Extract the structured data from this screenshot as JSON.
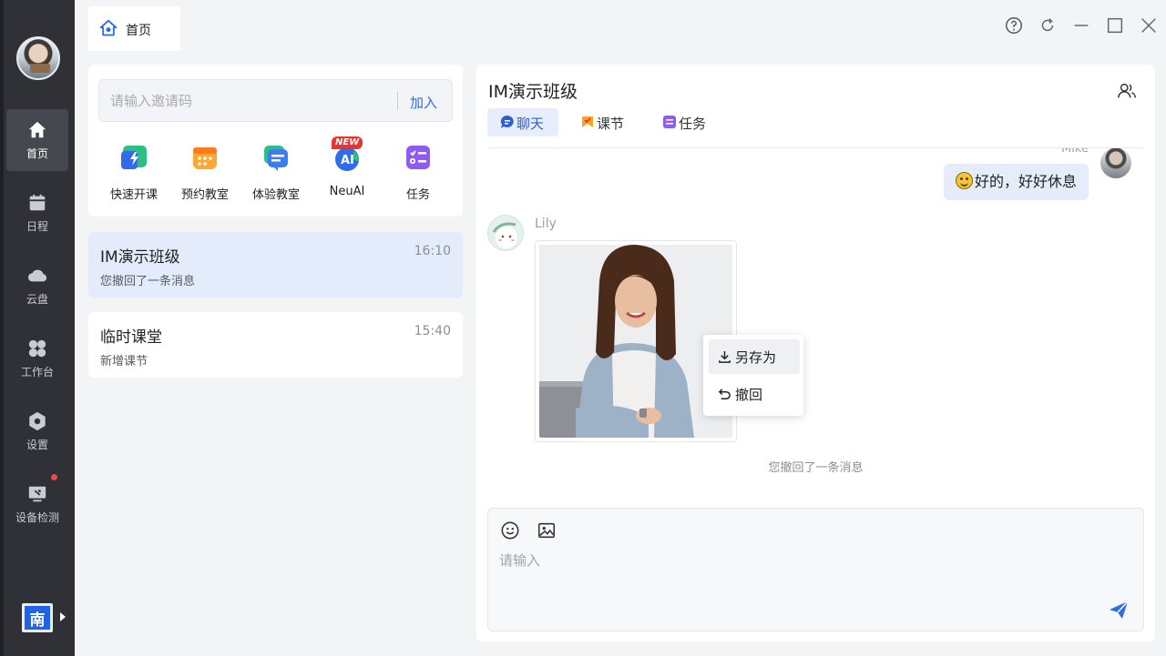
{
  "app": {
    "tab_label": "首页",
    "colors": {
      "accent": "#2f6bea",
      "sidebar_bg": "#2f3136",
      "active_item_bg": "#e4ecfb",
      "notification": "#f04848"
    }
  },
  "sidebar": {
    "items": [
      {
        "label": "首页",
        "icon": "home-icon"
      },
      {
        "label": "日程",
        "icon": "calendar-icon"
      },
      {
        "label": "云盘",
        "icon": "cloud-icon"
      },
      {
        "label": "工作台",
        "icon": "workbench-icon"
      },
      {
        "label": "设置",
        "icon": "settings-icon"
      },
      {
        "label": "设备检测",
        "icon": "device-check-icon"
      }
    ],
    "org_badge": "南"
  },
  "window_controls": [
    "help-icon",
    "refresh-icon",
    "minimize-icon",
    "maximize-icon",
    "close-icon"
  ],
  "invite": {
    "placeholder": "请输入邀请码",
    "join_label": "加入"
  },
  "quick_actions": [
    {
      "label": "快速开课",
      "icon": "quick-class-icon"
    },
    {
      "label": "预约教室",
      "icon": "reserve-classroom-icon"
    },
    {
      "label": "体验教室",
      "icon": "trial-classroom-icon"
    },
    {
      "label": "NeuAI",
      "icon": "neuai-icon",
      "badge": "NEW"
    },
    {
      "label": "任务",
      "icon": "task-icon"
    }
  ],
  "conversations": [
    {
      "title": "IM演示班级",
      "time": "16:10",
      "preview": "您撤回了一条消息"
    },
    {
      "title": "临时课堂",
      "time": "15:40",
      "preview": "新增课节"
    }
  ],
  "chat": {
    "title": "IM演示班级",
    "tabs": [
      {
        "label": "聊天",
        "icon": "chat-icon"
      },
      {
        "label": "课节",
        "icon": "lesson-icon"
      },
      {
        "label": "任务",
        "icon": "task-icon"
      }
    ],
    "messages": {
      "outgoing": {
        "sender": "Mike",
        "text": "好的，好好休息",
        "emoji": "smile-emoji"
      },
      "incoming": {
        "sender": "Lily",
        "type": "image"
      },
      "recall_note": "您撤回了一条消息"
    },
    "context_menu": [
      {
        "label": "另存为",
        "icon": "download-icon"
      },
      {
        "label": "撤回",
        "icon": "undo-icon"
      }
    ],
    "composer": {
      "placeholder": "请输入"
    }
  }
}
